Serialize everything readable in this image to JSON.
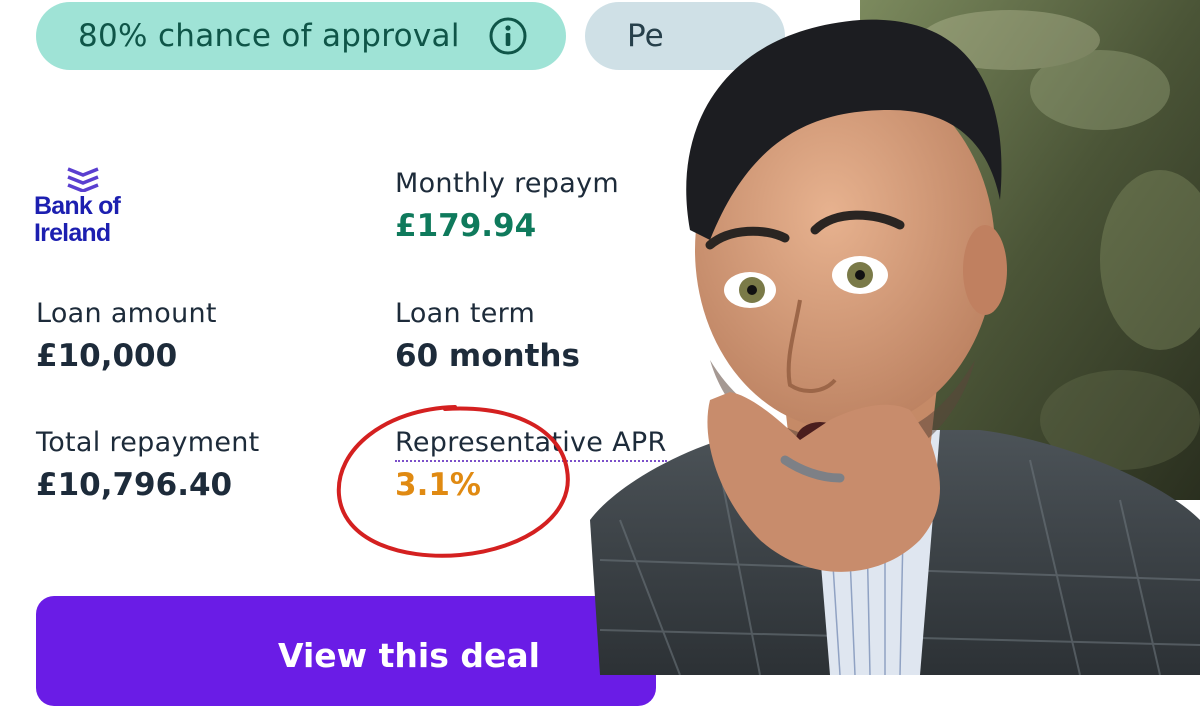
{
  "badges": {
    "approval": "80% chance of approval",
    "second": "Pe"
  },
  "lender": {
    "name_line1": "Bank of",
    "name_line2": "Ireland"
  },
  "fields": {
    "monthly_repayment": {
      "label": "Monthly repaym",
      "value": "£179.94"
    },
    "loan_amount": {
      "label": "Loan amount",
      "value": "£10,000"
    },
    "loan_term": {
      "label": "Loan term",
      "value": "60 months"
    },
    "total_repayment": {
      "label": "Total repayment",
      "value": "£10,796.40"
    },
    "apr": {
      "label": "Representative APR",
      "value": "3.1%"
    }
  },
  "cta": {
    "label": "View this deal"
  },
  "colors": {
    "approval_badge": "#9fe3d6",
    "monthly_value": "#0f7a5c",
    "apr_value": "#e08a12",
    "cta": "#6a1ce6",
    "circle": "#d42020"
  }
}
